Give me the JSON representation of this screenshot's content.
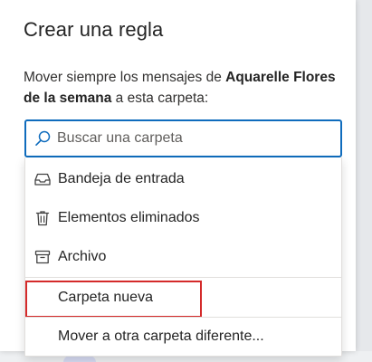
{
  "dialog": {
    "title": "Crear una regla",
    "description_prefix": "Mover siempre los mensajes de ",
    "description_sender": "Aquarelle Flores de la semana",
    "description_suffix": " a esta carpeta:"
  },
  "search": {
    "placeholder": "Buscar una carpeta",
    "icon": "search-icon"
  },
  "folders": [
    {
      "label": "Bandeja de entrada",
      "icon": "inbox-icon"
    },
    {
      "label": "Elementos eliminados",
      "icon": "trash-icon"
    },
    {
      "label": "Archivo",
      "icon": "archive-icon"
    }
  ],
  "actions": {
    "new_folder": "Carpeta nueva",
    "move_other": "Mover a otra carpeta diferente..."
  },
  "colors": {
    "accent": "#0f6cbd",
    "highlight": "#d42a2a",
    "text": "#242424"
  }
}
